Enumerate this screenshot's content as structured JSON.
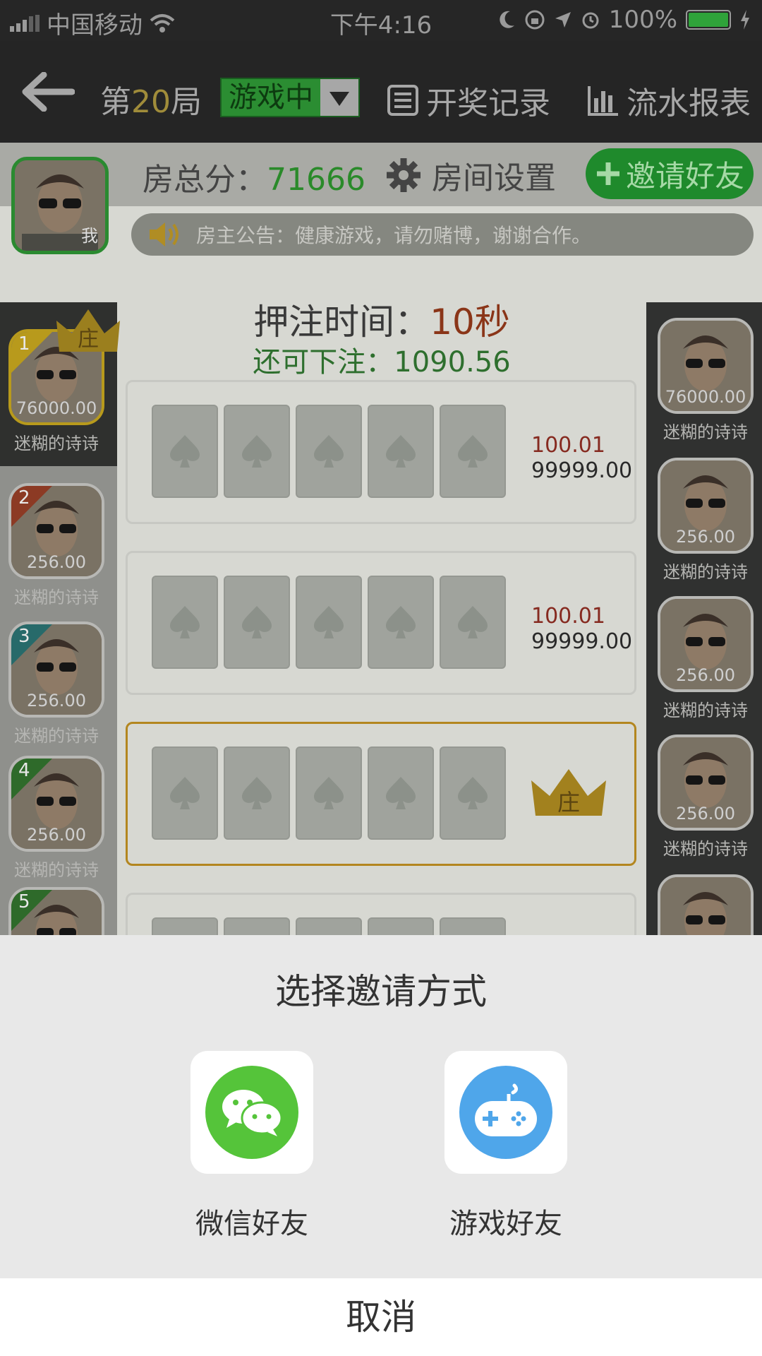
{
  "status_bar": {
    "carrier": "中国移动",
    "time": "下午4:16",
    "battery": "100%"
  },
  "header": {
    "round_prefix": "第",
    "round_number": "20",
    "round_suffix": "局",
    "game_state": "游戏中",
    "records": "开奖记录",
    "report": "流水报表"
  },
  "room": {
    "score_label": "房总分：",
    "score_value": "71666",
    "settings": "房间设置",
    "invite": "邀请好友",
    "me_tag": "我",
    "announcement": "房主公告：健康游戏，请勿赌博，谢谢合作。"
  },
  "betting": {
    "time_label": "押注时间：",
    "time_value": "10秒",
    "remaining": "还可下注：1090.56",
    "banker_mark": "庄",
    "rows": [
      {
        "a": "100.01",
        "b": "99999.00"
      },
      {
        "a": "100.01",
        "b": "99999.00"
      }
    ]
  },
  "left_players": [
    {
      "rank": "1",
      "amount": "76000.00",
      "name": "迷糊的诗诗",
      "crown": "庄"
    },
    {
      "rank": "2",
      "amount": "256.00",
      "name": "迷糊的诗诗"
    },
    {
      "rank": "3",
      "amount": "256.00",
      "name": "迷糊的诗诗"
    },
    {
      "rank": "4",
      "amount": "256.00",
      "name": "迷糊的诗诗"
    },
    {
      "rank": "5"
    }
  ],
  "right_players": [
    {
      "amount": "76000.00",
      "name": "迷糊的诗诗"
    },
    {
      "amount": "256.00",
      "name": "迷糊的诗诗"
    },
    {
      "amount": "256.00",
      "name": "迷糊的诗诗"
    },
    {
      "amount": "256.00",
      "name": "迷糊的诗诗"
    }
  ],
  "invite_sheet": {
    "title": "选择邀请方式",
    "wechat": "微信好友",
    "game_friend": "游戏好友",
    "cancel": "取消"
  },
  "colors": {
    "wechat_green": "#55c43a",
    "game_blue": "#4fa6ea",
    "header_bg": "#252525",
    "sheet_bg": "#e8e8e8"
  }
}
